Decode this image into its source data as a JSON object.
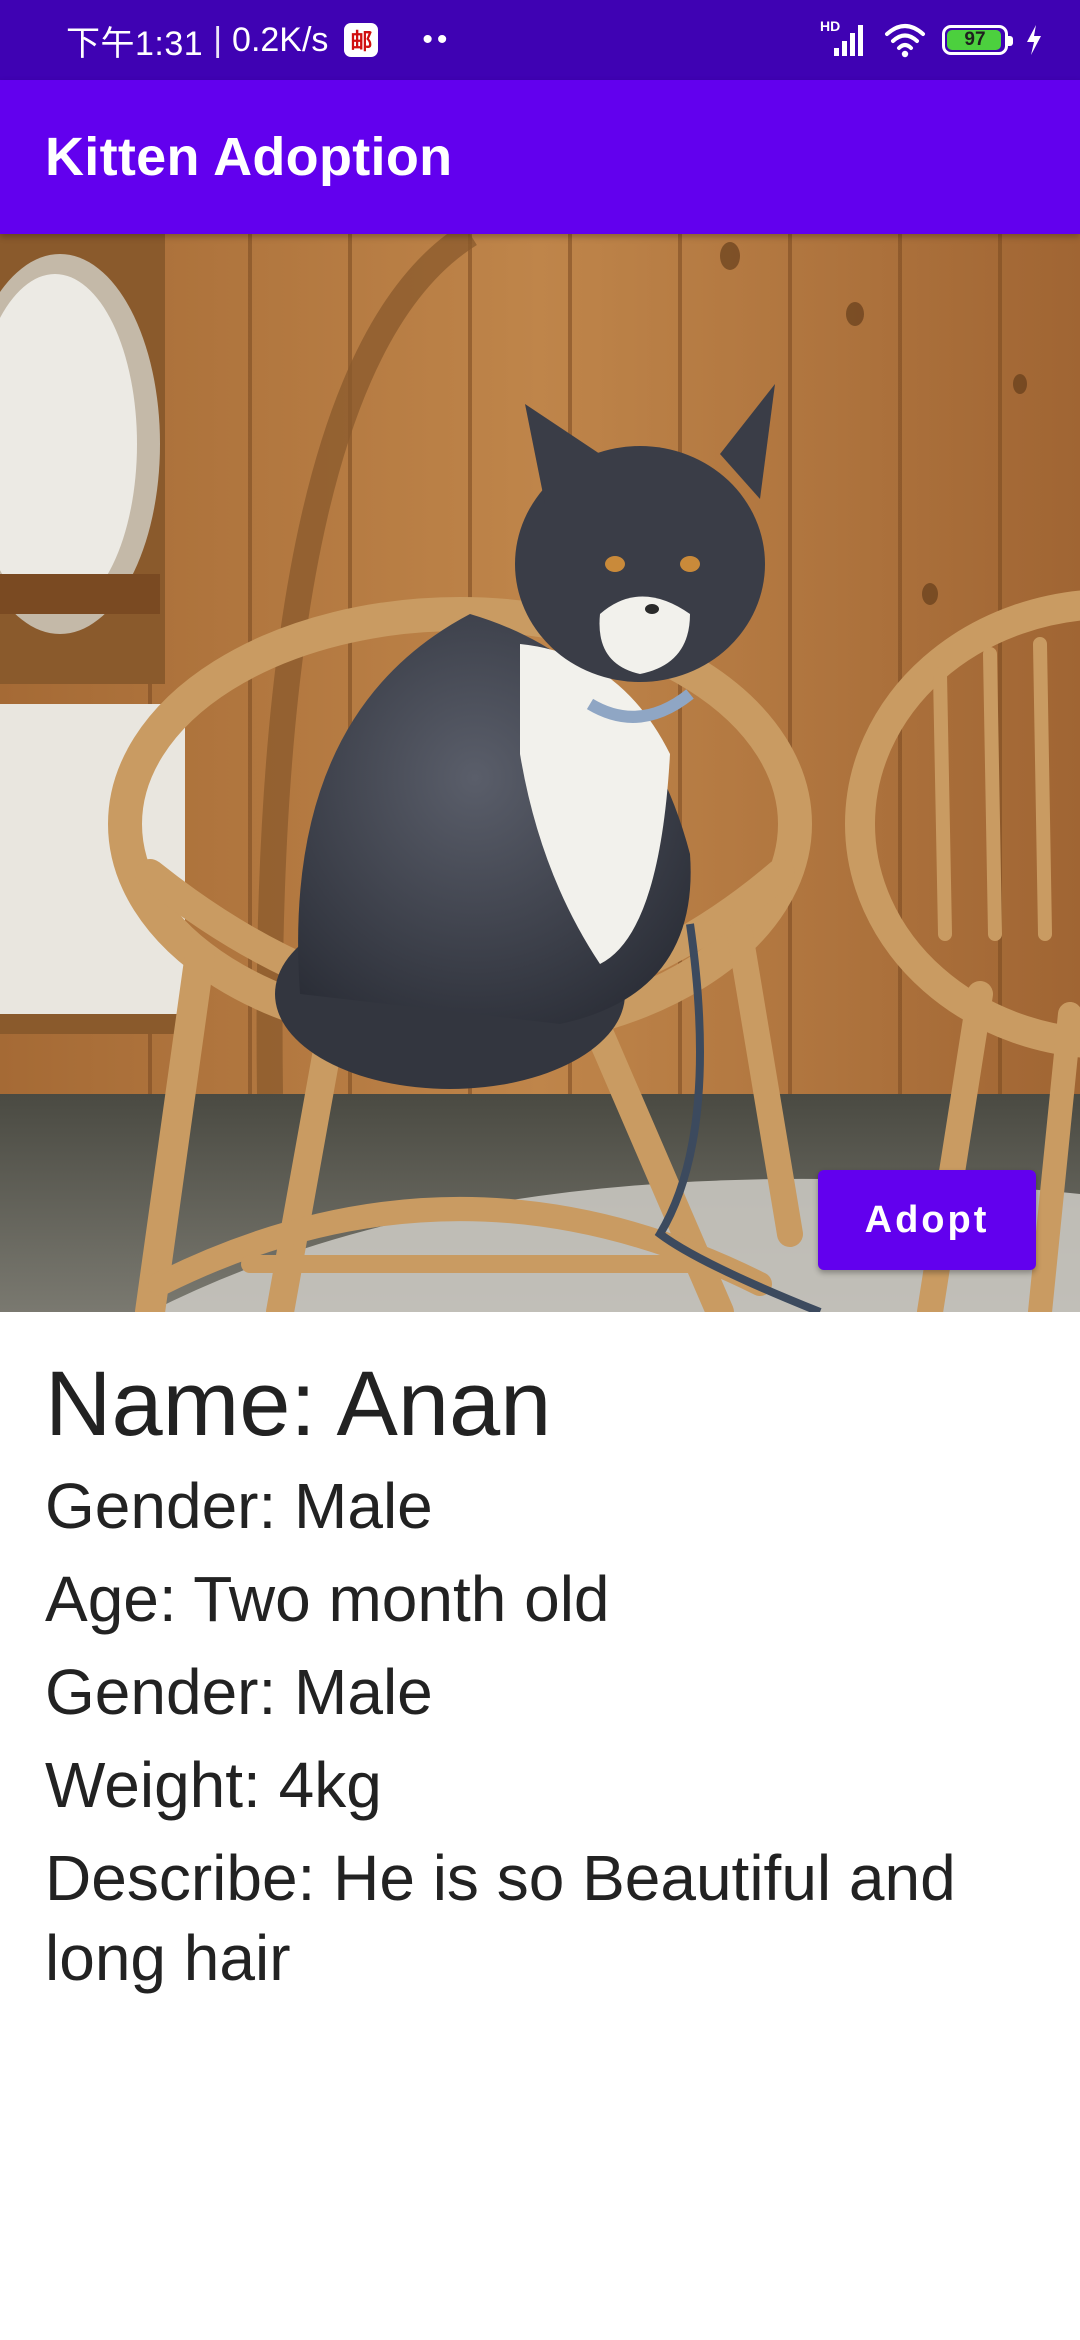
{
  "status_bar": {
    "time": "下午1:31",
    "separator": "|",
    "network_speed": "0.2K/s",
    "app_badge": "邮",
    "dots": "••",
    "hd_label": "HD",
    "battery_level": "97",
    "battery_fraction": 0.97,
    "icons": [
      "signal-icon",
      "wifi-icon",
      "battery-icon",
      "charging-icon"
    ]
  },
  "app_bar": {
    "title": "Kitten Adoption",
    "background": "#6200ee"
  },
  "hero": {
    "adopt_label": "Adopt"
  },
  "details": {
    "name": "Name: Anan",
    "gender": "Gender: Male",
    "age": "Age: Two month old",
    "gender_repeat": "Gender: Male",
    "weight": "Weight: 4kg",
    "describe": "Describe: He is so Beautiful and long hair"
  },
  "colors": {
    "status_bar": "#3f02b3",
    "primary": "#6200ee",
    "text": "#222222",
    "battery_fill": "#4cd03e"
  }
}
